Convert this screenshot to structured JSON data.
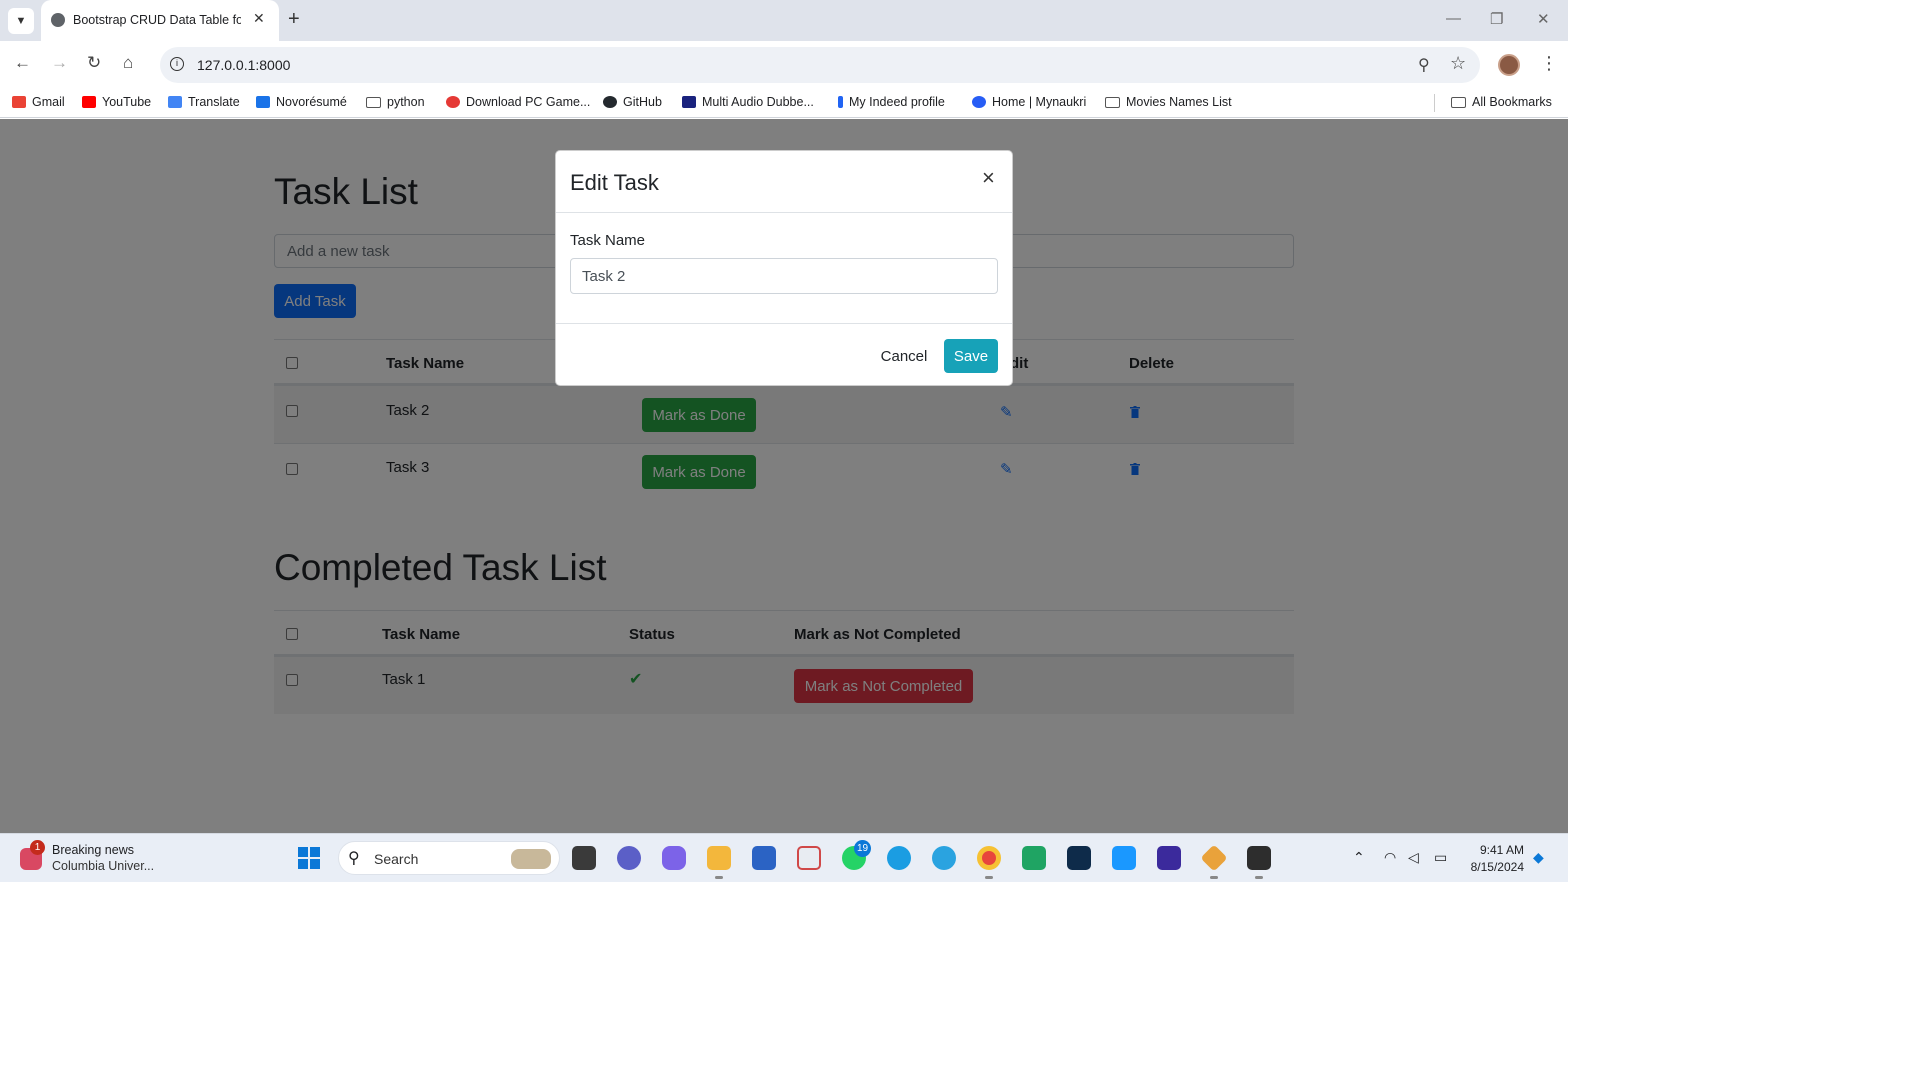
{
  "browser": {
    "tab_title": "Bootstrap CRUD Data Table for",
    "url": "127.0.0.1:8000",
    "bookmarks": [
      {
        "label": "Gmail",
        "icon": "gmail-icon",
        "color": "#ea4335"
      },
      {
        "label": "YouTube",
        "icon": "youtube-icon",
        "color": "#ff0000"
      },
      {
        "label": "Translate",
        "icon": "translate-icon",
        "color": "#4285f4"
      },
      {
        "label": "Novorésumé",
        "icon": "novoresume-icon",
        "color": "#1a73e8"
      },
      {
        "label": "python",
        "icon": "folder-icon",
        "color": ""
      },
      {
        "label": "Download PC Game...",
        "icon": "game-icon",
        "color": "#e53935"
      },
      {
        "label": "GitHub",
        "icon": "github-icon",
        "color": "#24292e"
      },
      {
        "label": "Multi Audio Dubbe...",
        "icon": "movie-icon",
        "color": "#1a237e"
      },
      {
        "label": "My Indeed profile",
        "icon": "indeed-icon",
        "color": "#2164f3"
      },
      {
        "label": "Home | Mynaukri",
        "icon": "naukri-icon",
        "color": "#275df5"
      },
      {
        "label": "Movies Names List",
        "icon": "folder-icon",
        "color": ""
      }
    ],
    "all_bookmarks": "All Bookmarks"
  },
  "page": {
    "task_list_title": "Task List",
    "new_task_placeholder": "Add a new task",
    "add_task_label": "Add Task",
    "task_table": {
      "headers": {
        "task_name": "Task Name",
        "edit": "Edit",
        "delete": "Delete"
      },
      "rows": [
        {
          "name": "Task 2",
          "action": "Mark as Done"
        },
        {
          "name": "Task 3",
          "action": "Mark as Done"
        }
      ]
    },
    "completed_title": "Completed Task List",
    "completed_table": {
      "headers": {
        "task_name": "Task Name",
        "status": "Status",
        "mark_not_completed": "Mark as Not Completed"
      },
      "rows": [
        {
          "name": "Task 1",
          "status_icon": "check-icon",
          "action": "Mark as Not Completed"
        }
      ]
    }
  },
  "modal": {
    "title": "Edit Task",
    "close_symbol": "×",
    "field_label": "Task Name",
    "field_value": "Task 2",
    "cancel_label": "Cancel",
    "save_label": "Save"
  },
  "taskbar": {
    "news_title": "Breaking news",
    "news_subtitle": "Columbia Univer...",
    "news_badge": "1",
    "search_label": "Search",
    "whatsapp_badge": "19",
    "time": "9:41 AM",
    "date": "8/15/2024"
  },
  "colors": {
    "primary": "#0d6efd",
    "success": "#28a745",
    "danger": "#dc3545",
    "info": "#17a2b8"
  }
}
